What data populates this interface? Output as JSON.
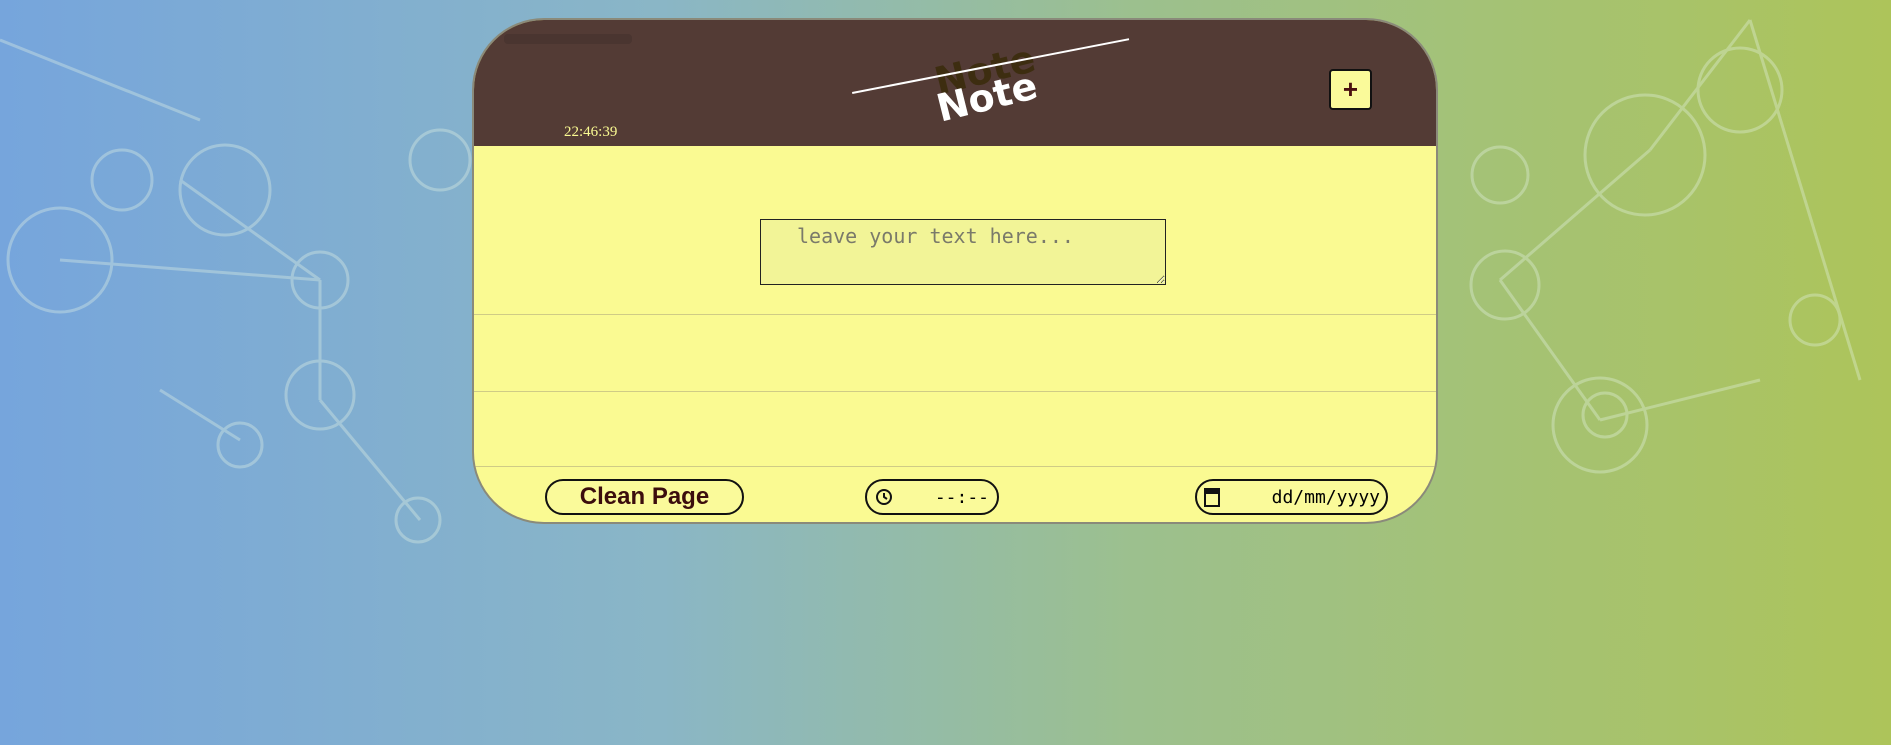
{
  "header": {
    "clock": "22:46:39",
    "title": "Note",
    "title_shadow": "Note",
    "add_label": "+"
  },
  "note": {
    "placeholder": "leave your text here...",
    "value": ""
  },
  "footer": {
    "clean_label": "Clean Page",
    "time_placeholder": "--:--",
    "date_placeholder": "dd/mm/yyyy"
  },
  "colors": {
    "header": "#533b35",
    "paper": "#fafa92",
    "accent_text": "#3b0d0d"
  },
  "icons": [
    "clock-icon",
    "calendar-icon",
    "plus-icon"
  ]
}
